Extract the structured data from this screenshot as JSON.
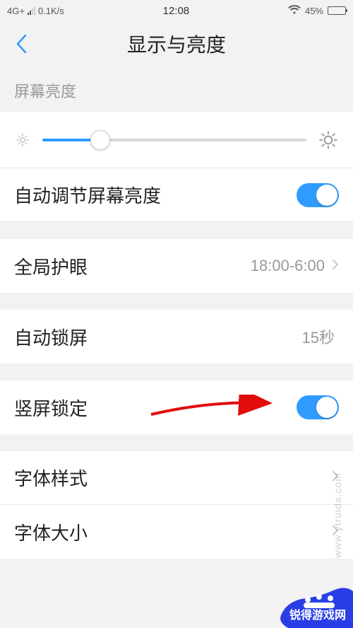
{
  "status": {
    "network": "4G+",
    "speed": "0.1K/s",
    "time": "12:08",
    "battery_pct": "45%"
  },
  "nav": {
    "title": "显示与亮度"
  },
  "brightness": {
    "section_label": "屏幕亮度",
    "slider_value_pct": 22
  },
  "rows": {
    "auto_brightness": {
      "label": "自动调节屏幕亮度",
      "toggle_on": true
    },
    "eye_protect": {
      "label": "全局护眼",
      "value": "18:00-6:00"
    },
    "auto_lock": {
      "label": "自动锁屏",
      "value": "15秒"
    },
    "portrait_lock": {
      "label": "竖屏锁定",
      "toggle_on": true
    },
    "font_style": {
      "label": "字体样式"
    },
    "font_size": {
      "label": "字体大小"
    }
  },
  "watermark": {
    "url": "www.ytruida.com",
    "badge": "锐得游戏网"
  }
}
